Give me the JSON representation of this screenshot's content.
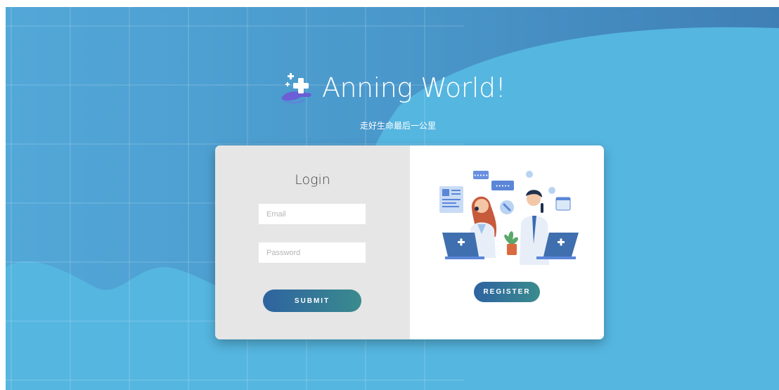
{
  "brand": {
    "title": "Anning World!",
    "tagline": "走好生命最后一公里",
    "logo_icon": "medical-cross-hand-icon"
  },
  "login": {
    "heading": "Login",
    "email_placeholder": "Email",
    "email_value": "",
    "password_placeholder": "Password",
    "password_value": "",
    "submit_label": "SUBMIT"
  },
  "register": {
    "illustration": "doctors-call-center-illustration",
    "register_label": "REGISTER"
  },
  "colors": {
    "background_dark": "#4c9bcc",
    "background_light": "#55b6e0",
    "button_start": "#2e63a0",
    "button_end": "#3a8b8e",
    "card_left": "#e6e6e6",
    "card_right": "#ffffff"
  }
}
